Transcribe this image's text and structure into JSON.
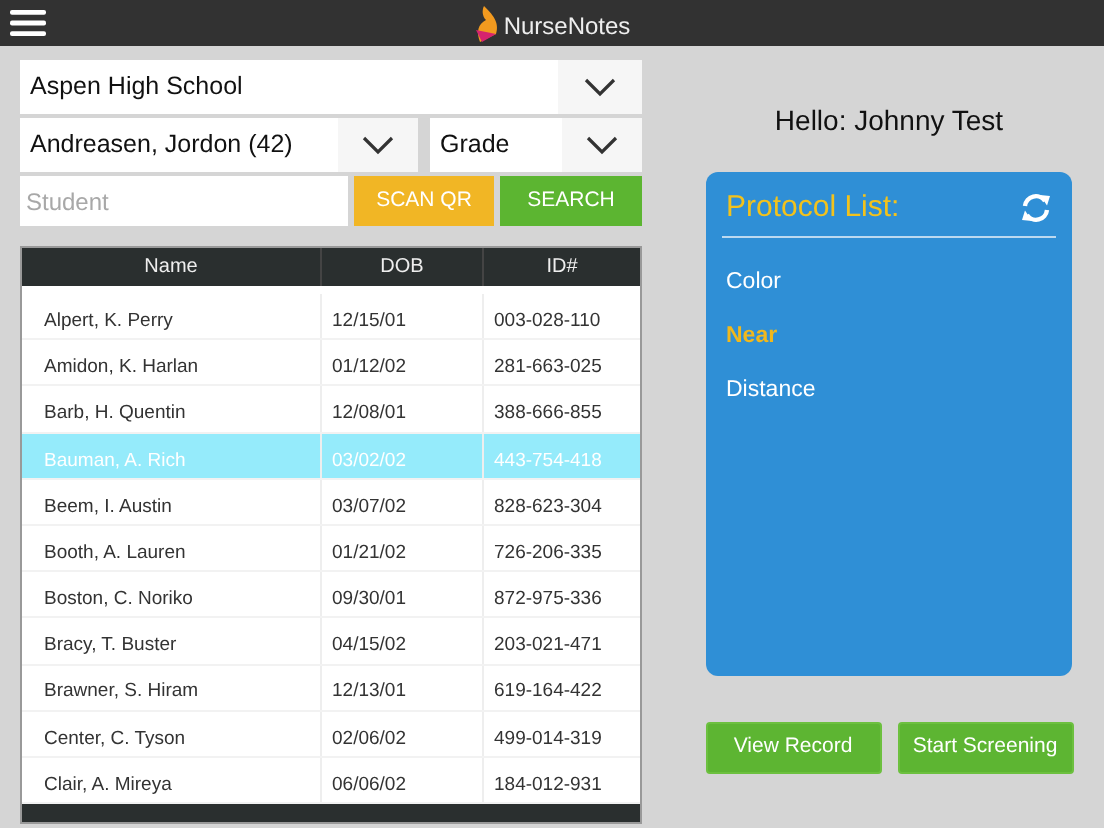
{
  "app": {
    "title": "NurseNotes"
  },
  "filters": {
    "school": "Aspen High School",
    "student_select": "Andreasen, Jordon (42)",
    "grade": {
      "placeholder": "Grade"
    },
    "student": {
      "placeholder": "Student"
    },
    "scan_button": "SCAN QR",
    "search_button": "SEARCH"
  },
  "table": {
    "columns": [
      "Name",
      "DOB",
      "ID#"
    ],
    "rows": [
      {
        "cells": [
          "Alpert, K. Perry",
          "12/15/01",
          "003-028-110"
        ],
        "selected": false
      },
      {
        "cells": [
          "Amidon, K. Harlan",
          "01/12/02",
          "281-663-025"
        ],
        "selected": false
      },
      {
        "cells": [
          "Barb, H. Quentin",
          "12/08/01",
          "388-666-855"
        ],
        "selected": false
      },
      {
        "cells": [
          "Bauman, A. Rich",
          "03/02/02",
          "443-754-418"
        ],
        "selected": true
      },
      {
        "cells": [
          "Beem, I. Austin",
          "03/07/02",
          "828-623-304"
        ],
        "selected": false
      },
      {
        "cells": [
          "Booth, A. Lauren",
          "01/21/02",
          "726-206-335"
        ],
        "selected": false
      },
      {
        "cells": [
          "Boston, C. Noriko",
          "09/30/01",
          "872-975-336"
        ],
        "selected": false
      },
      {
        "cells": [
          "Bracy, T. Buster",
          "04/15/02",
          "203-021-471"
        ],
        "selected": false
      },
      {
        "cells": [
          "Brawner, S. Hiram",
          "12/13/01",
          "619-164-422"
        ],
        "selected": false
      },
      {
        "cells": [
          "Center, C. Tyson",
          "02/06/02",
          "499-014-319"
        ],
        "selected": false
      },
      {
        "cells": [
          "Clair, A. Mireya",
          "06/06/02",
          "184-012-931"
        ],
        "selected": false
      }
    ]
  },
  "greeting": "Hello: Johnny Test",
  "protocol_list": {
    "title": "Protocol List:",
    "items": [
      {
        "label": "Color",
        "selected": false
      },
      {
        "label": "Near",
        "selected": true
      },
      {
        "label": "Distance",
        "selected": false
      }
    ]
  },
  "buttons": [
    "View Record",
    "Start Screening"
  ]
}
